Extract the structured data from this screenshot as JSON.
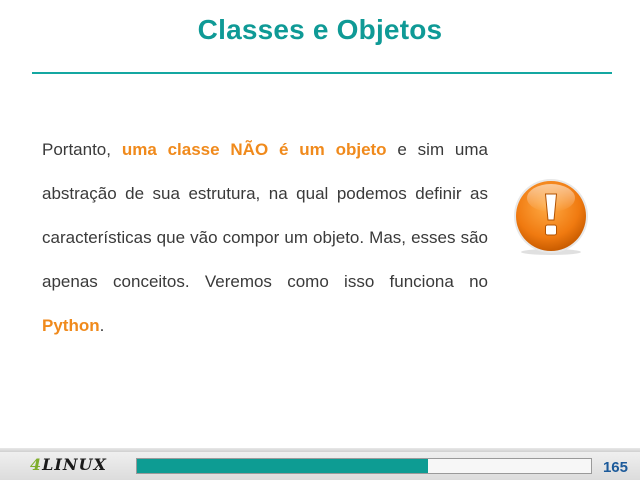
{
  "slide": {
    "title": "Classes e Objetos",
    "paragraph": {
      "part1": "Portanto, ",
      "highlight1": "uma classe NÃO é um objeto",
      "part2": " e sim uma abstração de sua estrutura, na qual podemos definir as características que vão compor um objeto. Mas, esses são apenas conceitos. Veremos como isso funciona no ",
      "highlight2": "Python",
      "part3": "."
    },
    "icon": "exclamation-alert-icon"
  },
  "footer": {
    "logo_text_four": "4",
    "logo_text_rest": "LINUX",
    "progress": 0.64,
    "page_number": "165"
  },
  "colors": {
    "title": "#0f9a96",
    "highlight": "#f08a1c",
    "progress": "#0d9c93",
    "page_number": "#1c5a9a"
  }
}
